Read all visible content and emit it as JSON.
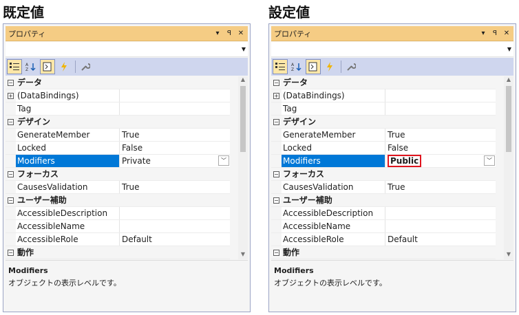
{
  "panels": [
    {
      "caption": "既定値",
      "title": "プロパティ",
      "title_buttons": [
        "▾",
        "ꟼ",
        "✕"
      ],
      "modifiers_value": "Private",
      "description_title": "Modifiers",
      "description_text": "オブジェクトの表示レベルです。"
    },
    {
      "caption": "設定値",
      "title": "プロパティ",
      "title_buttons": [
        "▾",
        "ꟼ",
        "✕"
      ],
      "modifiers_value": "Public",
      "description_title": "Modifiers",
      "description_text": "オブジェクトの表示レベルです。"
    }
  ],
  "grid": {
    "cat_data": "データ",
    "data_bindings": "(DataBindings)",
    "tag": "Tag",
    "cat_design": "デザイン",
    "generate_member": "GenerateMember",
    "generate_member_value": "True",
    "locked": "Locked",
    "locked_value": "False",
    "modifiers": "Modifiers",
    "cat_focus": "フォーカス",
    "causes_validation": "CausesValidation",
    "causes_validation_value": "True",
    "cat_accessibility": "ユーザー補助",
    "accessible_description": "AccessibleDescription",
    "accessible_name": "AccessibleName",
    "accessible_role": "AccessibleRole",
    "accessible_role_value": "Default",
    "cat_behavior": "動作",
    "expand_minus": "−",
    "expand_plus": "+"
  },
  "icons": {
    "categorized": "categorized-icon",
    "alphabetical": "alphabetical-sort-icon",
    "properties": "properties-icon",
    "events": "lightning-icon",
    "property_pages": "wrench-icon"
  },
  "colors": {
    "titlebar": "#f5cc84",
    "toolbar": "#cfd6ee",
    "selection": "#0078d7",
    "highlight_border": "#e0141e"
  }
}
